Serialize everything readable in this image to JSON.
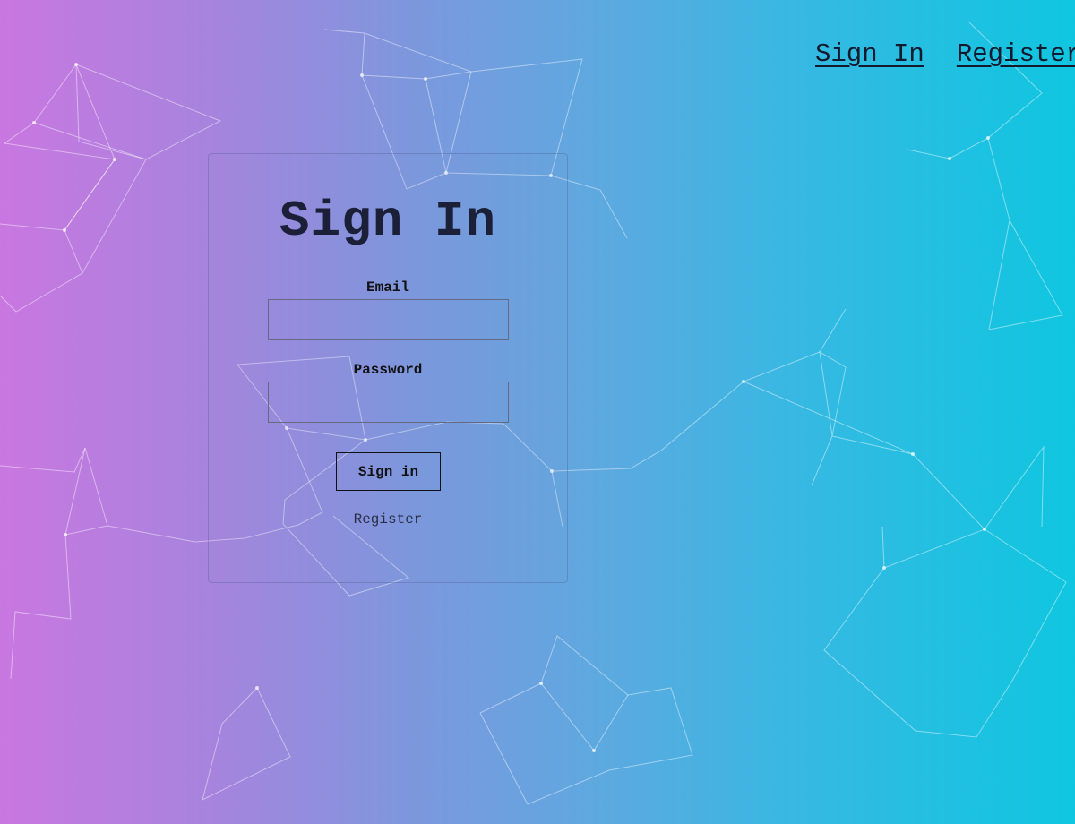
{
  "nav": {
    "sign_in": "Sign In",
    "register": "Register"
  },
  "form": {
    "title": "Sign In",
    "email_label": "Email",
    "email_value": "",
    "password_label": "Password",
    "password_value": "",
    "submit_label": "Sign in",
    "register_link": "Register"
  },
  "colors": {
    "gradient_start": "#c977e0",
    "gradient_end": "#0fc6e0",
    "text_dark": "#1b2038",
    "network_lines": "#ffffff"
  }
}
